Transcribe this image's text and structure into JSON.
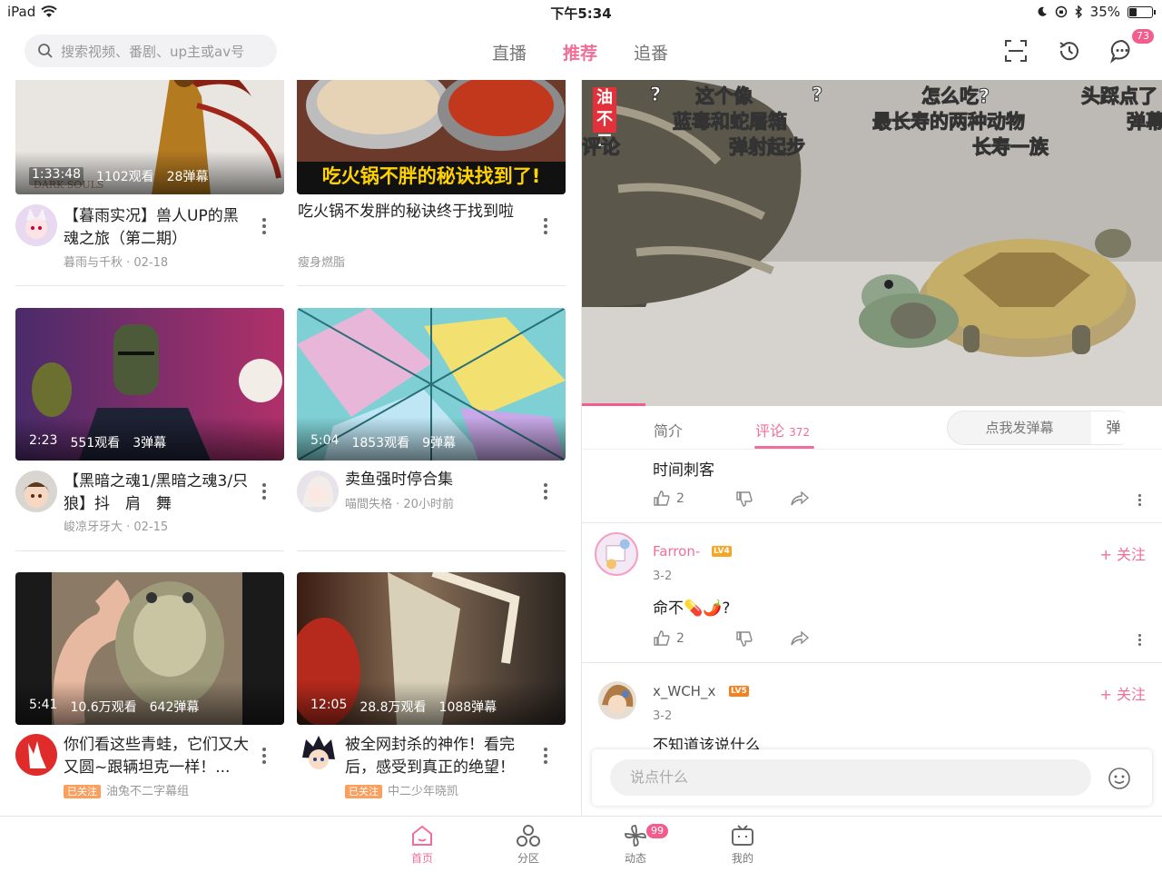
{
  "status_bar": {
    "device": "iPad",
    "time": "下午5:34",
    "battery": "35%",
    "battery_level": 0.35
  },
  "header": {
    "search_placeholder": "搜索视频、番剧、up主或av号",
    "tabs": [
      {
        "label": "直播",
        "active": false
      },
      {
        "label": "推荐",
        "active": true
      },
      {
        "label": "追番",
        "active": false
      }
    ],
    "message_badge": "73",
    "icons": [
      "scan-icon",
      "history-icon",
      "message-icon"
    ],
    "accent_color": "#f06f98"
  },
  "feed": {
    "cards": [
      {
        "duration": "1:33:48",
        "views": "1102观看",
        "danmaku": "28弹幕",
        "title": "【暮雨实况】兽人UP的黑魂之旅（第二期）",
        "author": "暮雨与千秋 · 02-18",
        "followed": false,
        "thumb_caption": "DARK SOULS"
      },
      {
        "duration": "",
        "views": "",
        "danmaku": "",
        "title": "吃火锅不发胖的秘诀终于找到啦",
        "author": "瘦身燃脂",
        "followed": false,
        "thumb_caption": "吃火锅不胖的秘诀找到了!"
      },
      {
        "duration": "2:23",
        "views": "551观看",
        "danmaku": "3弹幕",
        "title": "【黑暗之魂1/黑暗之魂3/只狼】抖　肩　舞",
        "author": "峻凉牙牙大 · 02-15",
        "followed": false
      },
      {
        "duration": "5:04",
        "views": "1853观看",
        "danmaku": "9弹幕",
        "title": "卖鱼强时停合集",
        "author": "喵間失格 · 20小时前",
        "followed": false
      },
      {
        "duration": "5:41",
        "views": "10.6万观看",
        "danmaku": "642弹幕",
        "title": "你们看这些青蛙，它们又大又圆~跟辆坦克一样！...",
        "author": "油兔不二字幕组",
        "followed": true
      },
      {
        "duration": "12:05",
        "views": "28.8万观看",
        "danmaku": "1088弹幕",
        "title": "被全网封杀的神作！看完后，感受到真正的绝望！",
        "author": "中二少年晓凯",
        "followed": true
      }
    ],
    "followed_label": "已关注"
  },
  "player": {
    "danmaku": [
      "这个像",
      "蓝毒和蛇屠箱",
      "弹射起步",
      "怎么吃?",
      "最长寿的两种动物",
      "长寿一族",
      "头踩点了",
      "弹幕",
      "?",
      "?",
      "评论"
    ],
    "logo": "油不二"
  },
  "detail": {
    "tabs": [
      {
        "label": "简介",
        "active": false
      },
      {
        "label": "评论",
        "count": "372",
        "active": true
      }
    ],
    "danmaku_placeholder": "点我发弹幕",
    "danmaku_toggle": "弹"
  },
  "comments": [
    {
      "text": "时间刺客",
      "likes": "2"
    },
    {
      "user": "Farron-",
      "level": "LV4",
      "level_color": "#f5a623",
      "date": "3-2",
      "text": "命不💊🌶️?",
      "likes": "2",
      "follow": "+ 关注",
      "name_color": "#f06f98"
    },
    {
      "user": "x_WCH_x",
      "level": "LV5",
      "level_color": "#f58020",
      "date": "3-2",
      "text": "不知道该说什么",
      "follow": "+ 关注",
      "name_color": "#555555"
    }
  ],
  "reply": {
    "placeholder": "说点什么"
  },
  "bottom_nav": [
    {
      "label": "首页",
      "icon": "home-icon",
      "active": true
    },
    {
      "label": "分区",
      "icon": "category-icon",
      "active": false
    },
    {
      "label": "动态",
      "icon": "dynamic-icon",
      "active": false,
      "badge": "99"
    },
    {
      "label": "我的",
      "icon": "tv-icon",
      "active": false
    }
  ]
}
